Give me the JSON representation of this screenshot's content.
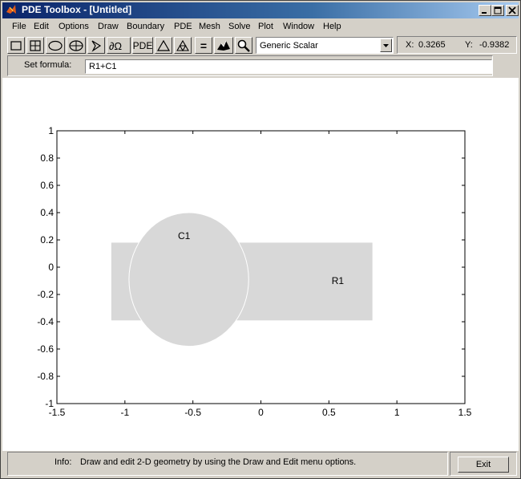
{
  "window": {
    "title": "PDE Toolbox - [Untitled]"
  },
  "menu": [
    "File",
    "Edit",
    "Options",
    "Draw",
    "Boundary",
    "PDE",
    "Mesh",
    "Solve",
    "Plot",
    "Window",
    "Help"
  ],
  "toolbar": {
    "pde_label": "PDE",
    "equals_label": "=",
    "mode_select": "Generic Scalar",
    "x_label": "X:",
    "x_value": "0.3265",
    "y_label": "Y:",
    "y_value": "-0.9382"
  },
  "formula": {
    "label": "Set formula:",
    "value": "R1+C1"
  },
  "status": {
    "label": "Info:",
    "text": "Draw and edit 2-D geometry by using the Draw and Edit menu options."
  },
  "exit_label": "Exit",
  "chart_data": {
    "type": "scatter",
    "xlim": [
      -1.5,
      1.5
    ],
    "ylim": [
      -1,
      1
    ],
    "xticks": [
      -1.5,
      -1,
      -0.5,
      0,
      0.5,
      1,
      1.5
    ],
    "xtick_labels": [
      "-1.5",
      "-1",
      "-0.5",
      "0",
      "0.5",
      "1",
      "1.5"
    ],
    "yticks": [
      -1,
      -0.8,
      -0.6,
      -0.4,
      -0.2,
      0,
      0.2,
      0.4,
      0.6,
      0.8,
      1
    ],
    "ytick_labels": [
      "-1",
      "-0.8",
      "-0.6",
      "-0.4",
      "-0.2",
      "0",
      "0.2",
      "0.4",
      "0.6",
      "0.8",
      "1"
    ],
    "shapes": [
      {
        "name": "R1",
        "kind": "rectangle",
        "x": [
          -1.1,
          0.82
        ],
        "y": [
          -0.39,
          0.18
        ],
        "label_at": [
          0.52,
          -0.1
        ]
      },
      {
        "name": "C1",
        "kind": "ellipse",
        "center": [
          -0.53,
          -0.09
        ],
        "rx": 0.44,
        "ry": 0.49,
        "label_at": [
          -0.61,
          0.23
        ]
      }
    ],
    "colors": {
      "fill": "#d8d8d8",
      "shape_edge": "#ffffff",
      "axes": "#000000"
    }
  }
}
